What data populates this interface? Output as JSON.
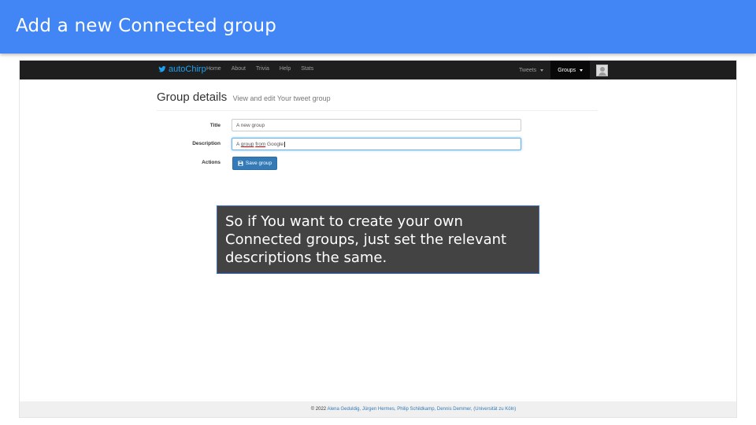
{
  "slide": {
    "title": "Add a new Connected group",
    "accent_color": "#4285f4"
  },
  "navbar": {
    "brand": "autoChirp",
    "brand_icon": "twitter-bird-icon",
    "links": [
      "Home",
      "About",
      "Trivia",
      "Help",
      "Stats"
    ],
    "tweets_dropdown": "Tweets",
    "groups_dropdown": "Groups",
    "avatar_icon": "user-avatar-icon"
  },
  "page": {
    "title": "Group details",
    "subtitle": "View and edit Your tweet group"
  },
  "form": {
    "title_label": "Title",
    "title_value": "A new group",
    "description_label": "Description",
    "description_value_parts": [
      "A",
      "group",
      "from",
      "Google"
    ],
    "actions_label": "Actions",
    "save_button_label": "Save group",
    "save_icon": "floppy-disk-icon"
  },
  "callout": {
    "text": "So if You want to create your own Connected groups, just set the relevant descriptions the same."
  },
  "footer": {
    "prefix": "© 2022",
    "authors": "Alena Geduldig, Jürgen Hermes, Philip Schildkamp, Dennis Demmer,",
    "institution": "(Universität zu Köln)"
  }
}
